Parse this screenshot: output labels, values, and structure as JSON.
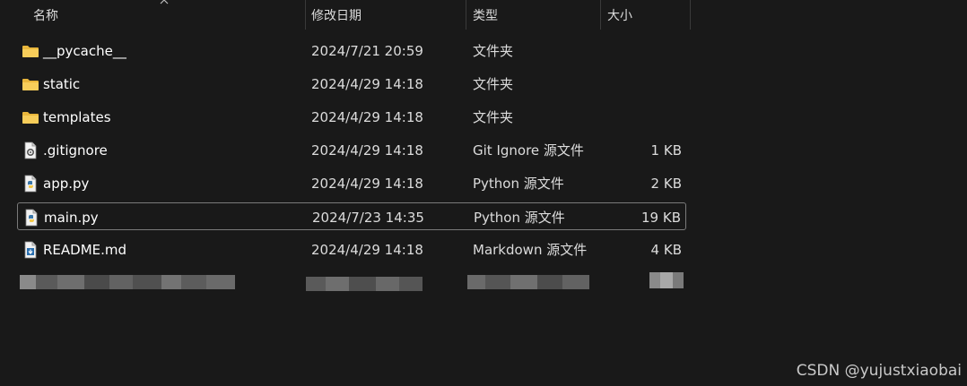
{
  "header": {
    "name_label": "名称",
    "date_label": "修改日期",
    "type_label": "类型",
    "size_label": "大小"
  },
  "files": [
    {
      "name": "__pycache__",
      "date": "2024/7/21 20:59",
      "type": "文件夹",
      "size": "",
      "icon": "folder-icon"
    },
    {
      "name": "static",
      "date": "2024/4/29 14:18",
      "type": "文件夹",
      "size": "",
      "icon": "folder-icon"
    },
    {
      "name": "templates",
      "date": "2024/4/29 14:18",
      "type": "文件夹",
      "size": "",
      "icon": "folder-icon"
    },
    {
      "name": ".gitignore",
      "date": "2024/4/29 14:18",
      "type": "Git Ignore 源文件",
      "size": "1 KB",
      "icon": "gear-file-icon"
    },
    {
      "name": "app.py",
      "date": "2024/4/29 14:18",
      "type": "Python 源文件",
      "size": "2 KB",
      "icon": "python-file-icon"
    },
    {
      "name": "main.py",
      "date": "2024/7/23 14:35",
      "type": "Python 源文件",
      "size": "19 KB",
      "icon": "python-file-icon",
      "selected": true
    },
    {
      "name": "README.md",
      "date": "2024/4/29 14:18",
      "type": "Markdown 源文件",
      "size": "4 KB",
      "icon": "markdown-file-icon"
    }
  ],
  "watermark": "CSDN @yujustxiaobai",
  "colors": {
    "background": "#191919",
    "folder": "#f4c44e",
    "selection_border": "#7a7a7a",
    "text": "#ffffff"
  }
}
